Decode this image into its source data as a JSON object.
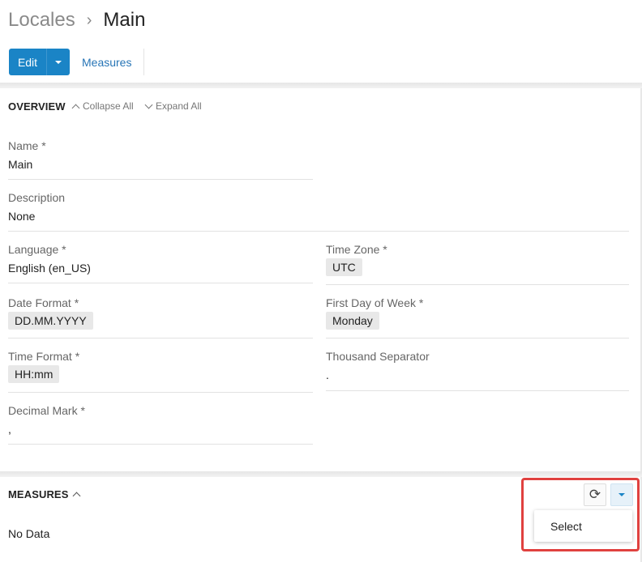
{
  "breadcrumb": {
    "parent": "Locales",
    "separator": "›",
    "current": "Main"
  },
  "toolbar": {
    "edit_label": "Edit",
    "measures_link": "Measures"
  },
  "overview": {
    "title": "OVERVIEW",
    "collapse_all": "Collapse All",
    "expand_all": "Expand All",
    "fields": {
      "name": {
        "label": "Name *",
        "value": "Main"
      },
      "description": {
        "label": "Description",
        "value": "None"
      },
      "language": {
        "label": "Language *",
        "value": "English (en_US)"
      },
      "time_zone": {
        "label": "Time Zone *",
        "value": "UTC"
      },
      "date_format": {
        "label": "Date Format *",
        "value": "DD.MM.YYYY"
      },
      "first_day_of_week": {
        "label": "First Day of Week *",
        "value": "Monday"
      },
      "time_format": {
        "label": "Time Format *",
        "value": "HH:mm"
      },
      "thousand_separator": {
        "label": "Thousand Separator",
        "value": "."
      },
      "decimal_mark": {
        "label": "Decimal Mark *",
        "value": ","
      }
    }
  },
  "measures": {
    "title": "MEASURES",
    "empty_text": "No Data",
    "dropdown": {
      "items": [
        "Select"
      ]
    }
  },
  "colors": {
    "primary": "#1a84c6",
    "link": "#2775b6",
    "highlight": "#e0413f"
  },
  "icons": {
    "refresh": "refresh-icon",
    "caret": "caret-down-icon"
  }
}
